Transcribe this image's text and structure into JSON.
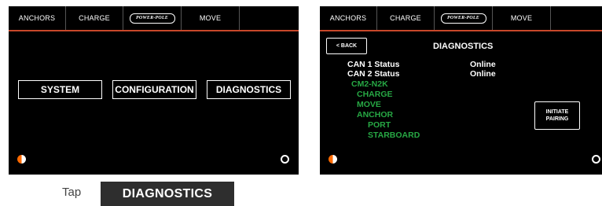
{
  "screen1": {
    "tabs": [
      "ANCHORS",
      "CHARGE",
      "POWER-POLE",
      "MOVE",
      ""
    ],
    "buttons": [
      "SYSTEM",
      "CONFIGURATION",
      "DIAGNOSTICS"
    ]
  },
  "screen2": {
    "tabs": [
      "ANCHORS",
      "CHARGE",
      "POWER-POLE",
      "MOVE",
      ""
    ],
    "back_label": "< BACK",
    "title": "DIAGNOSTICS",
    "can1_label": "CAN 1 Status",
    "can1_value": "Online",
    "can2_label": "CAN 2 Status",
    "can2_value": "Online",
    "devices": [
      "CM2-N2K",
      "CHARGE",
      "MOVE",
      "ANCHOR",
      "PORT",
      "STARBOARD"
    ],
    "pair_line1": "INITIATE",
    "pair_line2": "PAIRING"
  },
  "instruction": {
    "tap": "Tap",
    "target": "DIAGNOSTICS"
  },
  "colors": {
    "accent": "#c8482a",
    "status_green": "#27a844",
    "contrast_icon": "#ff6a00"
  },
  "icons": [
    "contrast-icon",
    "settings-gear-icon"
  ]
}
